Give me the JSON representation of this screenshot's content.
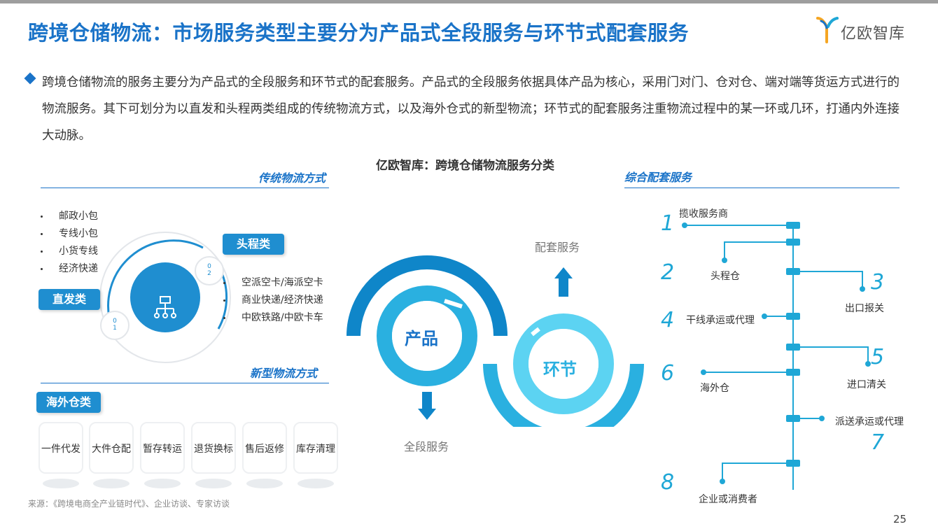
{
  "header": {
    "title": "跨境仓储物流：市场服务类型主要分为产品式全段服务与环节式配套服务",
    "logo_text": "亿欧智库"
  },
  "intro": {
    "text": "跨境仓储物流的服务主要分为产品式的全段服务和环节式的配套服务。产品式的全段服务依据具体产品为核心，采用门对门、仓对仓、端对端等货运方式进行的物流服务。其下可划分为以直发和头程两类组成的传统物流方式，以及海外仓式的新型物流；环节式的配套服务注重物流过程中的某一环或几环，打通内外连接大动脉。"
  },
  "diagram": {
    "title": "亿欧智库：跨境仓储物流服务分类"
  },
  "left": {
    "traditional_title": "传统物流方式",
    "new_title": "新型物流方式",
    "direct_tag": "直发类",
    "headhaul_tag": "头程类",
    "direct_items": [
      "邮政小包",
      "专线小包",
      "小货专线",
      "经济快递"
    ],
    "headhaul_items": [
      "空派空卡/海派空卡",
      "商业快递/经济快递",
      "中欧铁路/中欧卡车"
    ],
    "marker_01": "0\n1",
    "marker_02": "0\n2",
    "overseas_tag": "海外仓类",
    "overseas_items": [
      "一件代发",
      "大件仓配",
      "暂存转运",
      "退货换标",
      "售后返修",
      "库存清理"
    ]
  },
  "center": {
    "product_label": "产品",
    "link_label": "环节",
    "full_service": "全段服务",
    "supporting_service": "配套服务"
  },
  "right": {
    "title": "综合配套服务",
    "steps": [
      {
        "num": "1",
        "label": "揽收服务商"
      },
      {
        "num": "2",
        "label": "头程仓"
      },
      {
        "num": "3",
        "label": "出口报关"
      },
      {
        "num": "4",
        "label": "干线承运或代理"
      },
      {
        "num": "5",
        "label": "进口清关"
      },
      {
        "num": "6",
        "label": "海外仓"
      },
      {
        "num": "7",
        "label": "派送承运或代理"
      },
      {
        "num": "8",
        "label": "企业或消费者"
      }
    ]
  },
  "footer": {
    "source": "来源：《跨境电商全产业链时代》、企业访谈、专家访谈",
    "page": "25"
  },
  "colors": {
    "brand_blue": "#1a73c8",
    "tag_blue": "#1f8ed0",
    "ring_dark": "#0f86c9",
    "ring_light": "#3cc3ea",
    "timeline": "#1fa7d6"
  }
}
